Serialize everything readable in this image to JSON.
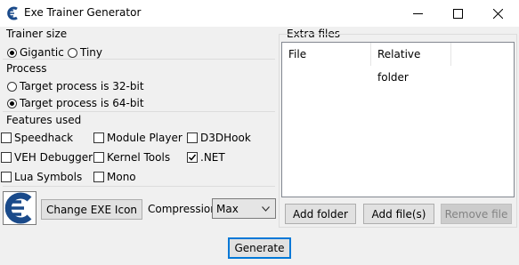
{
  "window": {
    "title": "Exe Trainer Generator"
  },
  "trainer_size": {
    "label": "Trainer size",
    "options": [
      {
        "label": "Gigantic",
        "selected": true
      },
      {
        "label": "Tiny",
        "selected": false
      }
    ]
  },
  "process": {
    "label": "Process",
    "options": [
      {
        "label": "Target process is 32-bit",
        "selected": false
      },
      {
        "label": "Target process is 64-bit",
        "selected": true
      }
    ]
  },
  "features": {
    "label": "Features used",
    "items": [
      {
        "label": "Speedhack",
        "checked": false
      },
      {
        "label": "Module Player",
        "checked": false
      },
      {
        "label": "D3DHook",
        "checked": false
      },
      {
        "label": "VEH Debugger",
        "checked": false
      },
      {
        "label": "Kernel Tools",
        "checked": false
      },
      {
        "label": ".NET",
        "checked": true
      },
      {
        "label": "Lua Symbols",
        "checked": false
      },
      {
        "label": "Mono",
        "checked": false
      }
    ]
  },
  "icon_row": {
    "change_icon_label": "Change EXE Icon",
    "compression_label": "Compression",
    "compression_value": "Max"
  },
  "extra_files": {
    "label": "Extra files",
    "columns": [
      "File",
      "Relative folder"
    ],
    "add_folder_label": "Add folder",
    "add_files_label": "Add file(s)",
    "remove_file_label": "Remove file"
  },
  "generate_label": "Generate",
  "colors": {
    "accent": "#0078d7",
    "icon_blue": "#1a4a8a"
  }
}
